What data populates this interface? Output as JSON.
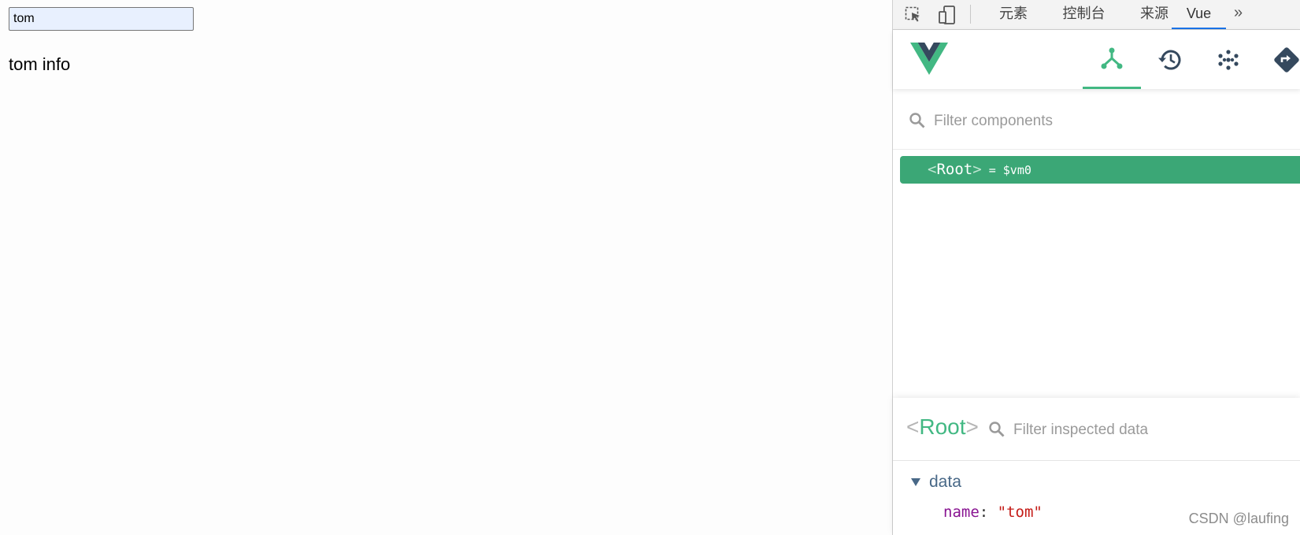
{
  "page": {
    "input_value": "tom",
    "info_text": "tom info"
  },
  "devtools": {
    "tabs": [
      {
        "label": "元素"
      },
      {
        "label": "控制台"
      },
      {
        "label": "来源"
      },
      {
        "label": "Vue",
        "active": true
      }
    ],
    "more_label": "»"
  },
  "vue": {
    "nav_icons": [
      "components-icon",
      "history-icon",
      "vuex-icon",
      "routing-icon"
    ],
    "active_nav": "components-icon",
    "filter_placeholder": "Filter components",
    "tree": {
      "lt": "<",
      "tag": "Root",
      "gt": ">",
      "ref": "= $vm0"
    },
    "inspector": {
      "lt": "<",
      "title": "Root",
      "gt": ">",
      "filter_placeholder": "Filter inspected data",
      "section": "data",
      "prop_key": "name",
      "prop_colon": ":",
      "prop_value": "\"tom\""
    }
  },
  "watermark": "CSDN @laufing",
  "colors": {
    "vue_green": "#42b883",
    "selected_row": "#3ba776",
    "active_tab_underline": "#1a73e8",
    "vue_dark": "#35495e"
  }
}
